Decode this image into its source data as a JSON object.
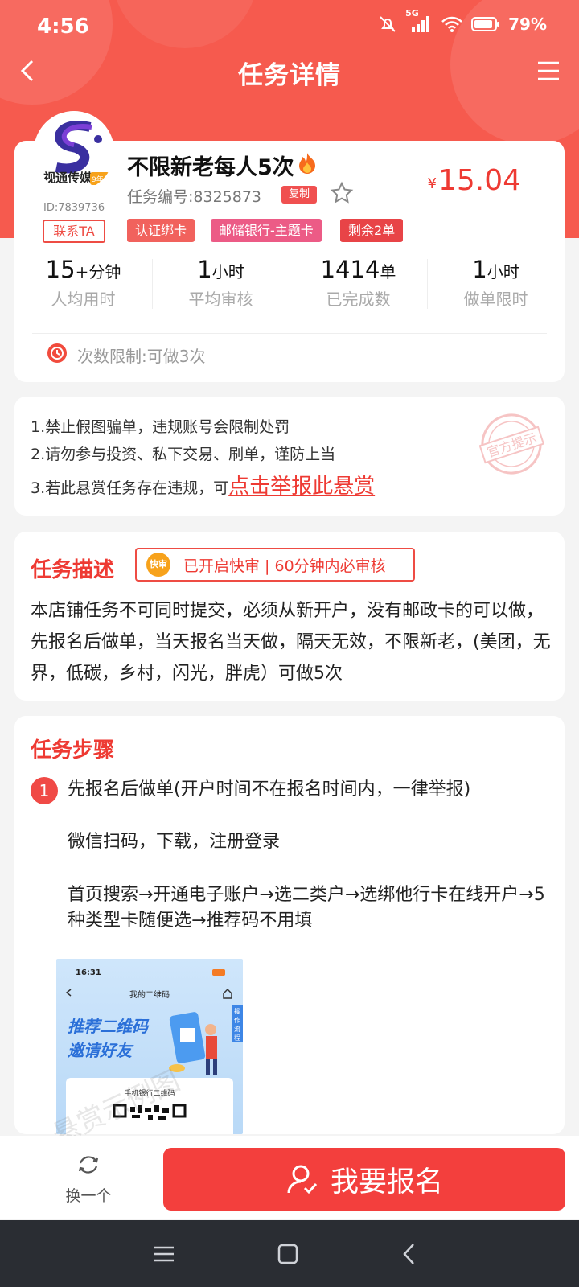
{
  "status_bar": {
    "time": "4:56",
    "battery": "79%",
    "network": "5G"
  },
  "nav": {
    "title": "任务详情"
  },
  "merchant": {
    "logo_text": "视通传媒",
    "logo_sub": "9年卡",
    "id": "ID:7839736",
    "contact_label": "联系TA"
  },
  "task": {
    "title": "不限新老每人5次",
    "code": "任务编号:8325873",
    "copy_label": "复制",
    "price_currency": "¥",
    "price": "15.04",
    "tags": [
      "认证绑卡",
      "邮储银行-主题卡",
      "剩余2单"
    ]
  },
  "stats": [
    {
      "value": "15",
      "unit": "+分钟",
      "label": "人均用时"
    },
    {
      "value": "1",
      "unit": "小时",
      "label": "平均审核"
    },
    {
      "value": "1414",
      "unit": "单",
      "label": "已完成数"
    },
    {
      "value": "1",
      "unit": "小时",
      "label": "做单限时"
    }
  ],
  "limit_text": "次数限制:可做3次",
  "rules": {
    "line1": "1.禁止假图骗单，违规账号会限制处罚",
    "line2": "2.请勿参与投资、私下交易、刷单，谨防上当",
    "line3_prefix": "3.若此悬赏任务存在违规，可",
    "line3_link": "点击举报此悬赏",
    "stamp": "官方提示"
  },
  "description": {
    "title": "任务描述",
    "fast_icon": "快审",
    "fast_text": "已开启快审 | 60分钟内必审核",
    "body": "本店铺任务不可同时提交，必须从新开户，没有邮政卡的可以做，先报名后做单，当天报名当天做，隔天无效，不限新老，(美团，无界，低碳，乡村，闪光，胖虎）可做5次"
  },
  "steps": {
    "title": "任务步骤",
    "items": [
      {
        "num": "1",
        "heading": "先报名后做单(开户时间不在报名时间内，一律举报)",
        "line2": "微信扫码，下载，注册登录",
        "line3": "首页搜索→开通电子账户→选二类户→选绑他行卡在线开户→5种类型卡随便选→推荐码不用填"
      }
    ],
    "screenshot": {
      "time": "16:31",
      "title": "我的二维码",
      "headline1": "推荐二维码",
      "headline2": "邀请好友",
      "side": "操作流程",
      "card_title": "手机银行二维码"
    },
    "watermark": "悬赏示例图"
  },
  "actions": {
    "swap_label": "换一个",
    "signup_label": "我要报名"
  },
  "colors": {
    "accent": "#f33f3d",
    "hero": "#f65a4e"
  }
}
